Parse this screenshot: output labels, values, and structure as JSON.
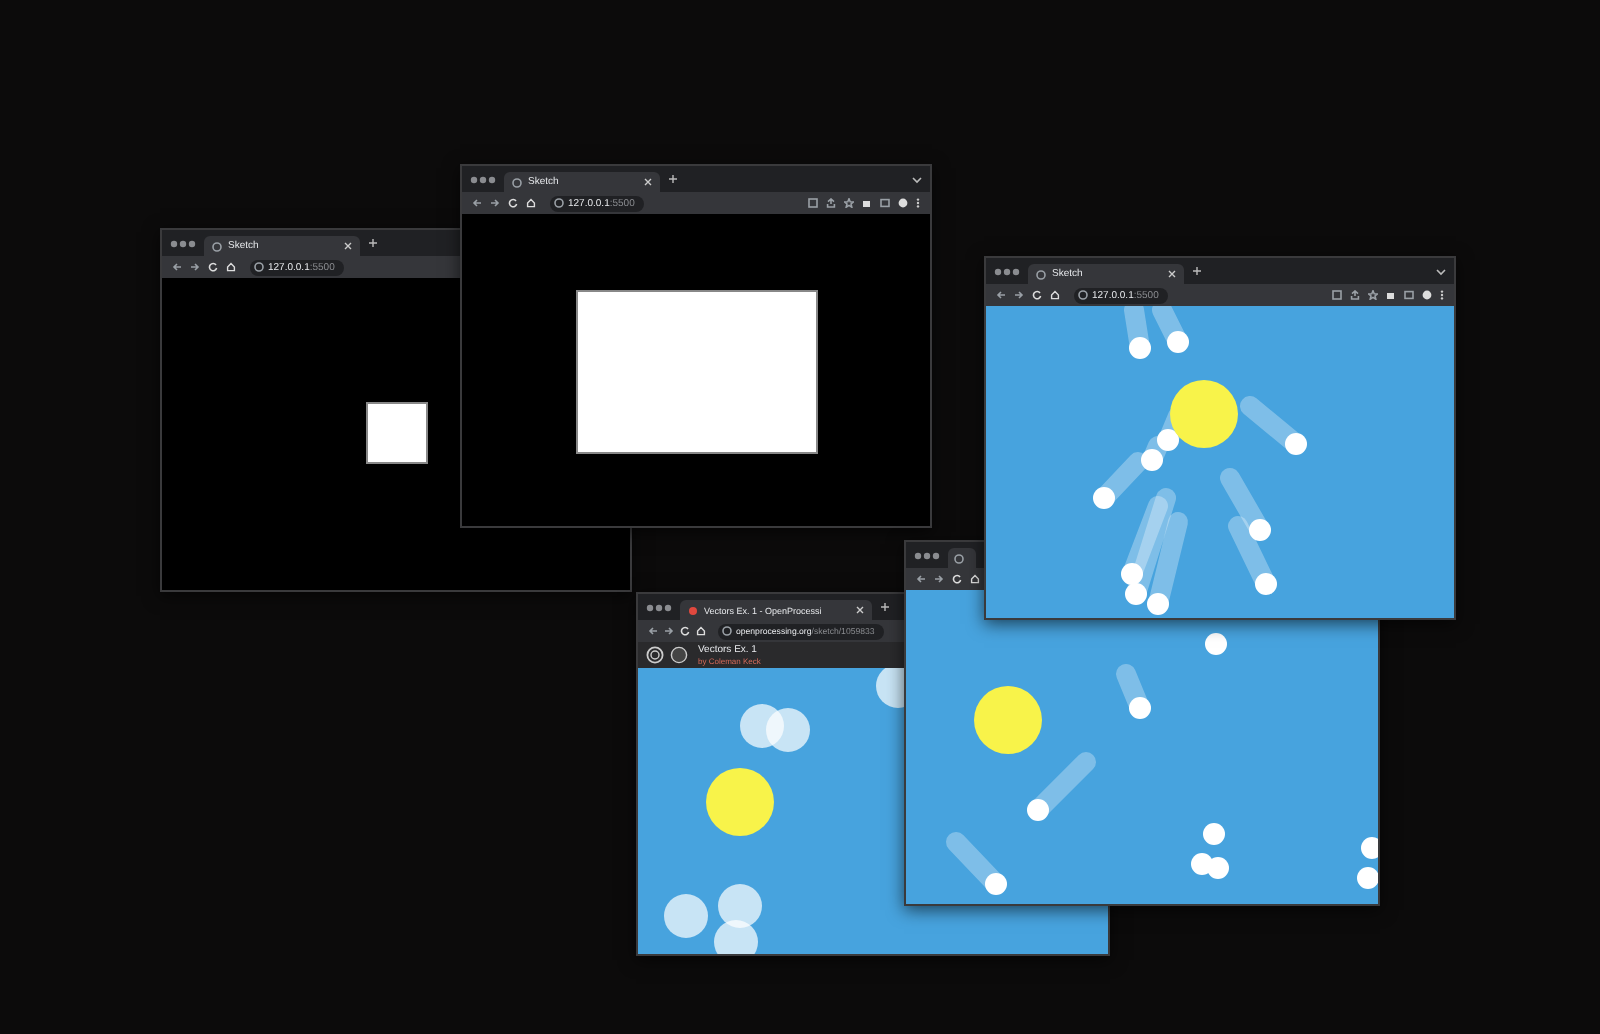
{
  "windows": [
    {
      "tab_title": "Sketch",
      "url_host": "127.0.0.1",
      "url_path": ":5500",
      "kind": "blank"
    },
    {
      "tab_title": "Sketch",
      "url_host": "127.0.0.1",
      "url_path": ":5500",
      "toolbar_extras": true,
      "tab_menu": true,
      "kind": "blank"
    },
    {
      "tab_title": "Vectors Ex. 1 - OpenProcessi",
      "url_host": "openprocessing.org",
      "url_path": "/sketch/1059833",
      "kind": "animation",
      "site_header": {
        "title": "Vectors Ex. 1",
        "author": "by Coleman Keck"
      }
    },
    {
      "kind": "animation"
    },
    {
      "tab_title": "Sketch",
      "url_host": "127.0.0.1",
      "url_path": ":5500",
      "toolbar_extras": true,
      "tab_menu": true,
      "kind": "animation"
    }
  ]
}
